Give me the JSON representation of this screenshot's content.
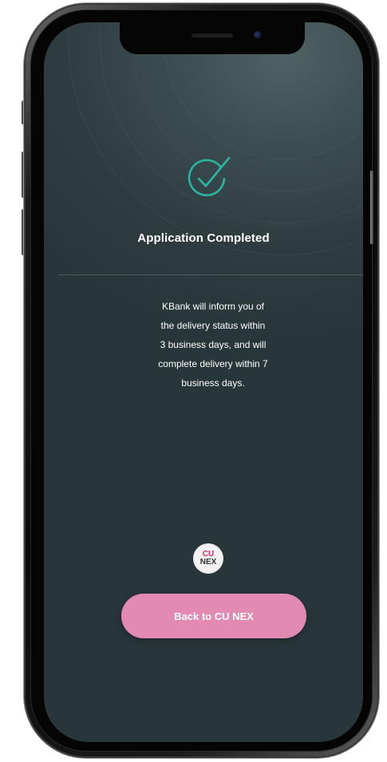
{
  "screen": {
    "title": "Application Completed",
    "message_lines": [
      "KBank will inform you of",
      "the delivery status within",
      "3 business days, and will",
      "complete delivery within 7",
      "business days."
    ],
    "logo": {
      "line1": "CU",
      "line2": "NEX"
    },
    "back_button_label": "Back to CU NEX",
    "check_icon": "checkmark-circle-icon"
  },
  "colors": {
    "accent": "#2bb7a1",
    "button": "#e38ab3",
    "background": "#2f3d41",
    "logo_brand": "#d02a6a"
  }
}
